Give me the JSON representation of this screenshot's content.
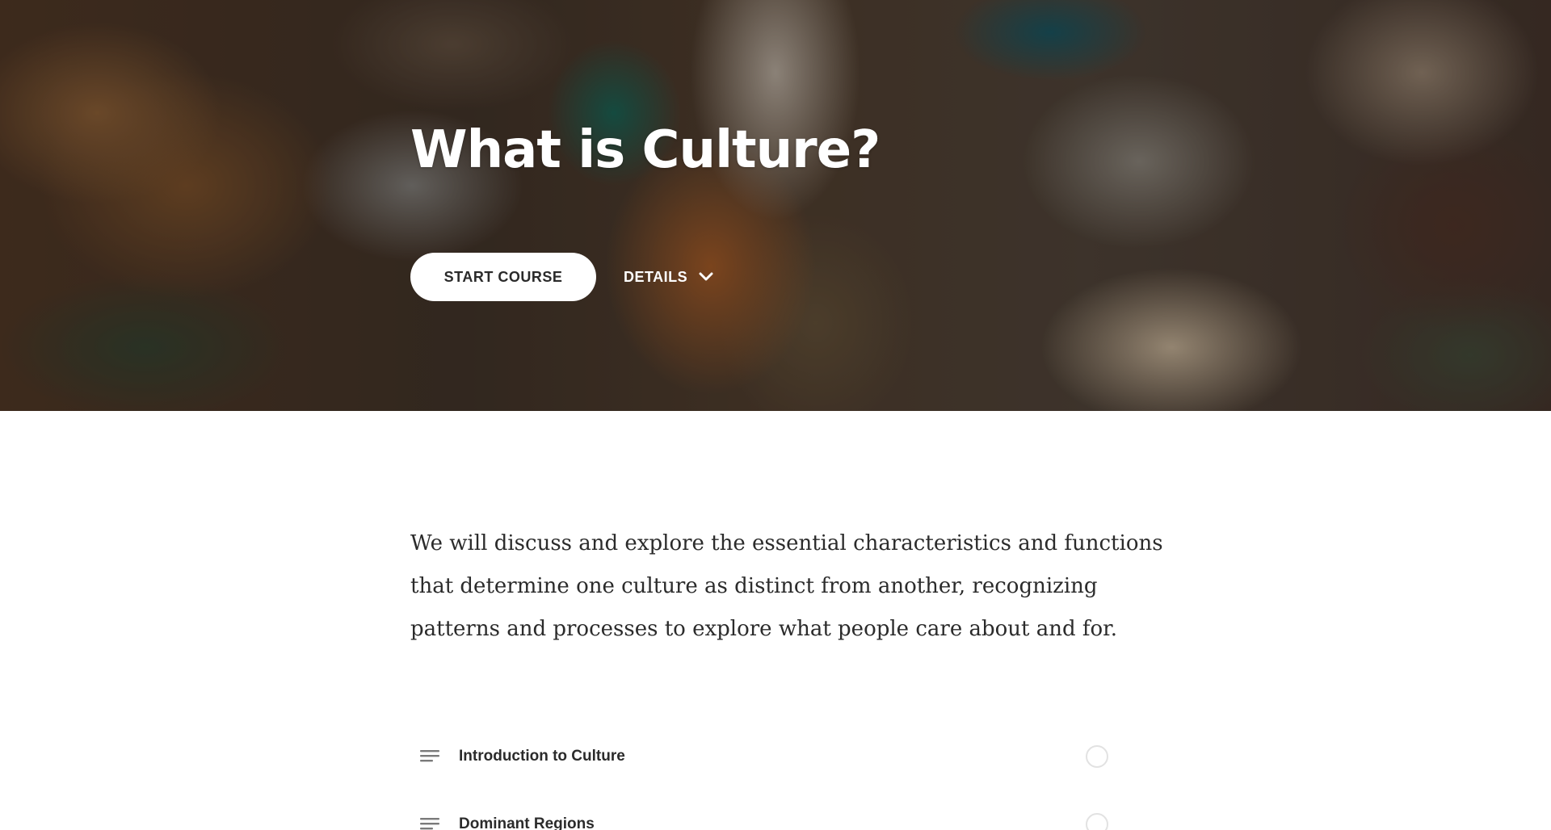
{
  "hero": {
    "title": "What is Culture?",
    "start_label": "START COURSE",
    "details_label": "DETAILS",
    "background_icon": "market-photo",
    "overlay_color": "#000000"
  },
  "description": "We will discuss and explore the essential characteristics and functions that determine one culture as distinct from another, recognizing patterns and processes to explore what people care about and for.",
  "lessons": [
    {
      "title": "Introduction to Culture",
      "icon": "text-lines-icon",
      "status": "not-started"
    },
    {
      "title": "Dominant Regions",
      "icon": "text-lines-icon",
      "status": "not-started"
    }
  ],
  "colors": {
    "text": "#2b2b2b",
    "button_bg": "#ffffff",
    "status_ring": "#e2e2e2"
  }
}
